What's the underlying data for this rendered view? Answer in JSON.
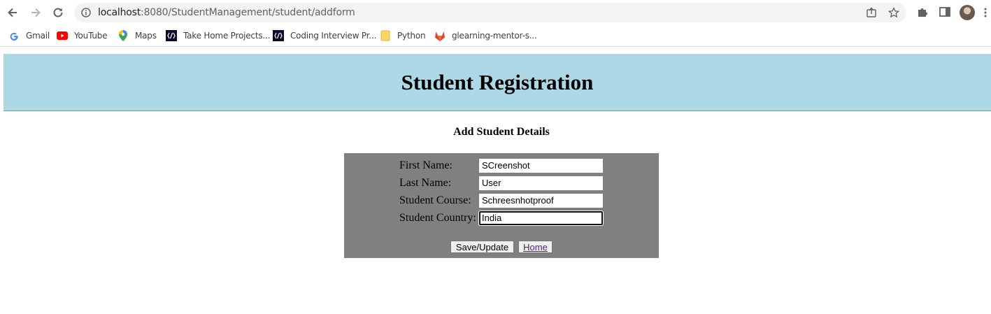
{
  "browser": {
    "url_host": "localhost",
    "url_path": ":8080/StudentManagement/student/addform",
    "bookmarks": [
      {
        "label": "Gmail",
        "icon": "google-icon"
      },
      {
        "label": "YouTube",
        "icon": "youtube-icon"
      },
      {
        "label": "Maps",
        "icon": "maps-icon"
      },
      {
        "label": "Take Home Projects...",
        "icon": "lambda-icon"
      },
      {
        "label": "Coding Interview Pr...",
        "icon": "lambda-icon"
      },
      {
        "label": "Python",
        "icon": "folder-icon"
      },
      {
        "label": "glearning-mentor-s...",
        "icon": "gitlab-icon"
      }
    ]
  },
  "page": {
    "title": "Student Registration",
    "subtitle": "Add Student Details",
    "header_color": "#add8e6",
    "form_color": "#808080"
  },
  "form": {
    "first_name_label": "First Name:",
    "first_name_value": "SCreenshot",
    "last_name_label": "Last Name:",
    "last_name_value": "User",
    "course_label": "Student Course:",
    "course_value": "Schreesnhotproof",
    "country_label": "Student Country:",
    "country_value": "India",
    "save_label": "Save/Update",
    "home_label": "Home"
  }
}
